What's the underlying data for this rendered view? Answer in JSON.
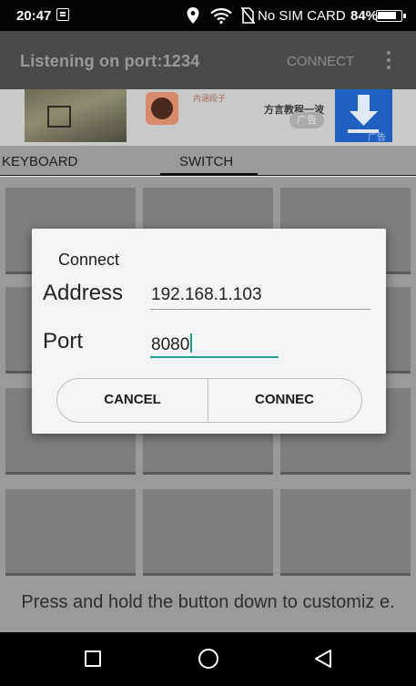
{
  "status_bar": {
    "time": "20:47",
    "carrier": "No SIM CARD",
    "battery": "84%",
    "battery_level": 0.84,
    "icons": [
      "notification-icon",
      "location-icon",
      "wifi-icon",
      "no-sim-icon",
      "battery-icon"
    ]
  },
  "app_bar": {
    "title": "Listening on port:1234",
    "connect_label": "CONNECT",
    "menu_icon": "more-vert-icon"
  },
  "ad_banner": {
    "text_small": "内涵段子",
    "text_main": "方言教程一波",
    "tag": "广告",
    "download_label": "广告",
    "download_icon": "download-icon"
  },
  "tabs": [
    {
      "label": "KEYBOARD"
    },
    {
      "label": "SWITCH",
      "selected": true
    }
  ],
  "grid": {
    "hint": "Press and hold the button down to customiz e."
  },
  "dialog": {
    "title": "Connect",
    "address_label": "Address",
    "address_value": "192.168.1.103",
    "port_label": "Port",
    "port_value": "8080",
    "cancel_label": "CANCEL",
    "connect_label": "CONNEC"
  },
  "nav_bar": {
    "icons": [
      "recents-icon",
      "home-icon",
      "back-icon"
    ]
  },
  "colors": {
    "accent": "#1c9f8f",
    "dialog_bg": "#f4f4f4",
    "scrim_appbar": "#4a4a4a",
    "ad_download": "#2060c0"
  }
}
